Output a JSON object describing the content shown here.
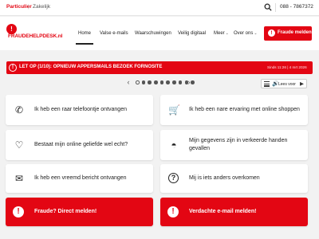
{
  "topbar": {
    "segment_private": "Particulier",
    "segment_divider": "|",
    "segment_business": "Zakelijk",
    "phone": "088 - 7867372",
    "search_icon": "search-icon"
  },
  "header": {
    "logo_badge": "!",
    "logo_text": "FRAUDEHELPDESK.nl",
    "nav": [
      {
        "label": "Home",
        "icon": null
      },
      {
        "label": "Valse e-mails",
        "icon": null
      },
      {
        "label": "Waarschuwingen",
        "icon": null
      },
      {
        "label": "Veilig digitaal",
        "icon": null
      },
      {
        "label": "Meer",
        "icon": "chevron-down-icon"
      },
      {
        "label": "Over ons",
        "icon": "chevron-down-icon"
      }
    ],
    "nav_chevron": "⌄",
    "cta_icon": "!",
    "cta_label": "Fraude melden"
  },
  "alert": {
    "icon": "!",
    "text": "LET OP (1/10): OPNIEUW APPERSMAILS BEZOEK FORNOSITE",
    "date": "Sinds 11:26 | 4 mrt 2026"
  },
  "carousel": {
    "dots": 10,
    "active_index": 0,
    "prev": "‹",
    "next": "›"
  },
  "reader": {
    "speaker": "🔊",
    "label": "Lees voor",
    "play": "▶"
  },
  "cards": [
    {
      "label": "Ik heb een raar telefoontje ontvangen",
      "icon": "phone-icon",
      "glyph": "✆",
      "red": false
    },
    {
      "label": "Ik heb een nare ervaring met online shoppen",
      "icon": "cart-icon",
      "glyph": "🛒",
      "red": false
    },
    {
      "label": "Bestaat mijn online geliefde wel echt?",
      "icon": "heart-icon",
      "glyph": "♡",
      "red": false
    },
    {
      "label": "Mijn gegevens zijn in verkeerde handen gevallen",
      "icon": "mask-icon",
      "glyph": "◓",
      "red": false
    },
    {
      "label": "Ik heb een vreemd bericht ontvangen",
      "icon": "envelope-icon",
      "glyph": "✉",
      "red": false
    },
    {
      "label": "Mij is iets anders overkomen",
      "icon": "question-icon",
      "glyph": "?",
      "red": false
    },
    {
      "label": "Fraude? Direct melden!",
      "icon": "alert-icon",
      "glyph": "!",
      "red": true
    },
    {
      "label": "Verdachte e-mail melden!",
      "icon": "alert-icon",
      "glyph": "!",
      "red": true
    }
  ]
}
